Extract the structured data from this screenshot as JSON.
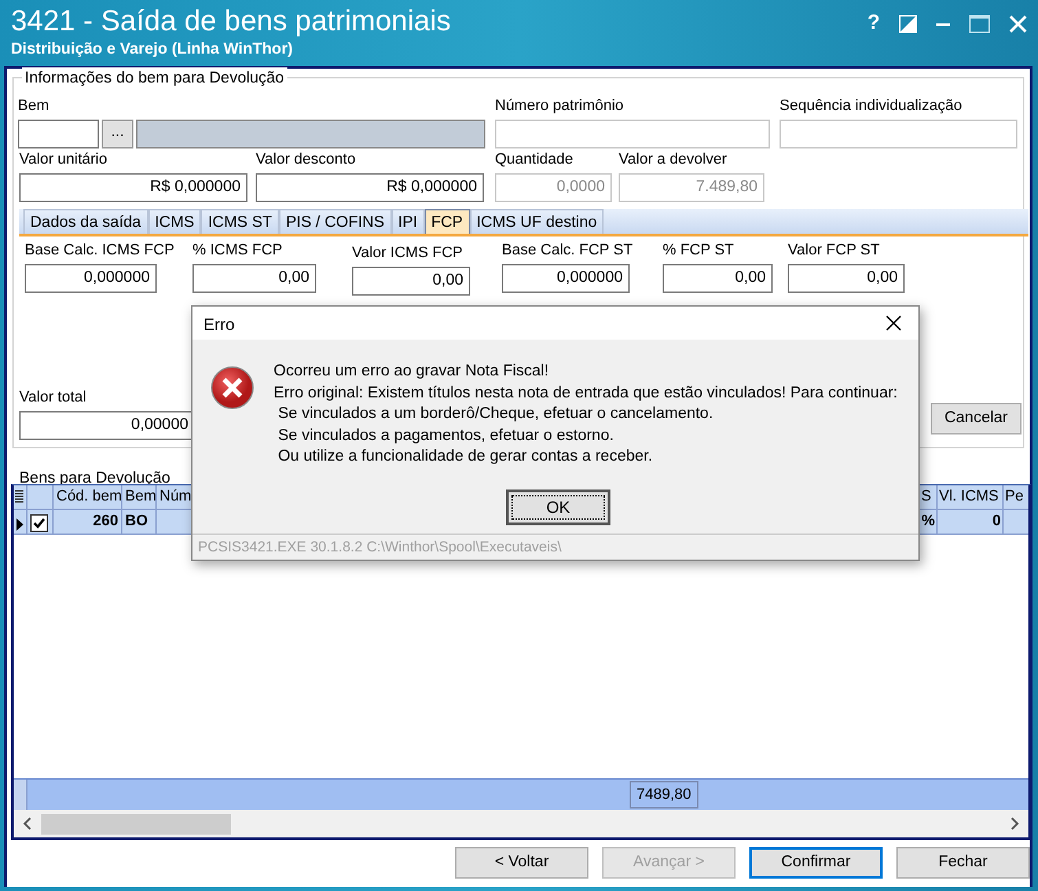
{
  "window": {
    "title": "3421 - Saída de bens patrimoniais",
    "subtitle": "Distribuição e Varejo (Linha WinThor)",
    "help_button": "?"
  },
  "info_group": {
    "title": "Informações do bem para Devolução",
    "bem": {
      "label": "Bem",
      "lookup_button": "..."
    },
    "row1": [
      {
        "label": "Número patrimônio",
        "disabled": true
      },
      {
        "label": "Sequência individualização",
        "disabled": true
      }
    ],
    "row2": [
      {
        "label": "Valor unitário",
        "value": "R$ 0,000000",
        "disabled": false
      },
      {
        "label": "Valor desconto",
        "value": "R$ 0,000000",
        "disabled": false
      },
      {
        "label": "Quantidade",
        "value": "0,0000",
        "disabled": true
      },
      {
        "label": "Valor a devolver",
        "value": "7.489,80",
        "disabled": true
      }
    ]
  },
  "tabs": [
    {
      "label": "Dados da saída",
      "selected": false
    },
    {
      "label": "ICMS",
      "selected": false
    },
    {
      "label": "ICMS ST",
      "selected": false
    },
    {
      "label": "PIS / COFINS",
      "selected": false
    },
    {
      "label": "IPI",
      "selected": false
    },
    {
      "label": "FCP",
      "selected": true
    },
    {
      "label": "ICMS UF destino",
      "selected": false
    }
  ],
  "fcp_fields": [
    {
      "label": "Base Calc. ICMS FCP",
      "value": "0,000000"
    },
    {
      "label": "% ICMS FCP",
      "value": "0,00"
    },
    {
      "label": "Valor ICMS FCP",
      "value": "0,00"
    },
    {
      "label": "Base Calc. FCP ST",
      "value": "0,000000"
    },
    {
      "label": "% FCP ST",
      "value": "0,00"
    },
    {
      "label": "Valor FCP ST",
      "value": "0,00"
    }
  ],
  "total": {
    "label": "Valor total",
    "value": "0,00000"
  },
  "cancel_button": "Cancelar",
  "grid": {
    "title": "Bens para Devolução",
    "columns": [
      "Cód. bem",
      "Bem",
      "Núm",
      "S",
      "Vl. ICMS",
      "Pe"
    ],
    "rows": [
      {
        "selected": true,
        "checked": true,
        "cells": [
          "260",
          "BO",
          null,
          "%",
          "0",
          null
        ]
      }
    ],
    "footer_total": "7489,80"
  },
  "buttons": [
    {
      "label": "< Voltar",
      "disabled": false,
      "default": false
    },
    {
      "label": "Avançar >",
      "disabled": true,
      "default": false
    },
    {
      "label": "Confirmar",
      "disabled": false,
      "default": true
    },
    {
      "label": "Fechar",
      "disabled": false,
      "default": false
    }
  ],
  "dialog": {
    "title": "Erro",
    "lines": [
      "Ocorreu um erro ao gravar Nota Fiscal!",
      "Erro original: Existem títulos nesta nota de entrada que estão vinculados! Para continuar:",
      " Se vinculados a um borderô/Cheque, efetuar o cancelamento.",
      " Se vinculados a pagamentos, efetuar o estorno.",
      " Ou utilize a funcionalidade de gerar contas a receber."
    ],
    "ok_button": "OK",
    "status": "PCSIS3421.EXE 30.1.8.2 C:\\Winthor\\Spool\\Executaveis\\"
  }
}
